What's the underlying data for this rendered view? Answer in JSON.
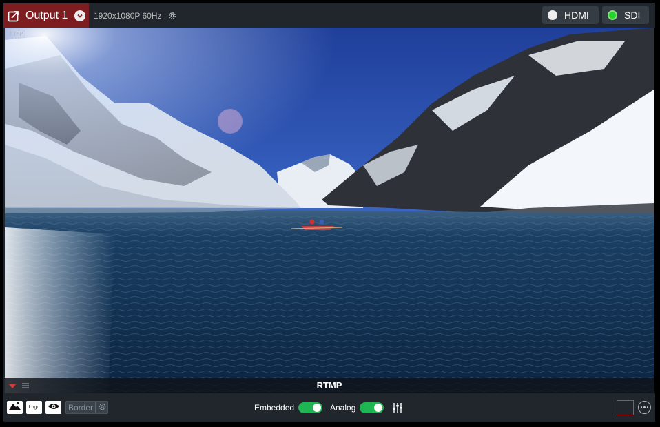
{
  "header": {
    "output_title": "Output 1",
    "resolution": "1920x1080P 60Hz",
    "outputs": [
      {
        "label": "HDMI",
        "active": false,
        "indicator_color": "#eeeeee"
      },
      {
        "label": "SDI",
        "active": true,
        "indicator_color": "#2ad22a"
      }
    ]
  },
  "preview": {
    "corner_tag": "RTMP",
    "source_label": "RTMP"
  },
  "toolbar": {
    "logo_label": "Logo",
    "border_label": "Border",
    "embedded_label": "Embedded",
    "embedded_on": true,
    "analog_label": "Analog",
    "analog_on": true
  },
  "colors": {
    "accent_tab": "#7d1d1f",
    "toggle_on": "#1fb553",
    "record_outline": "#d83a3a"
  }
}
